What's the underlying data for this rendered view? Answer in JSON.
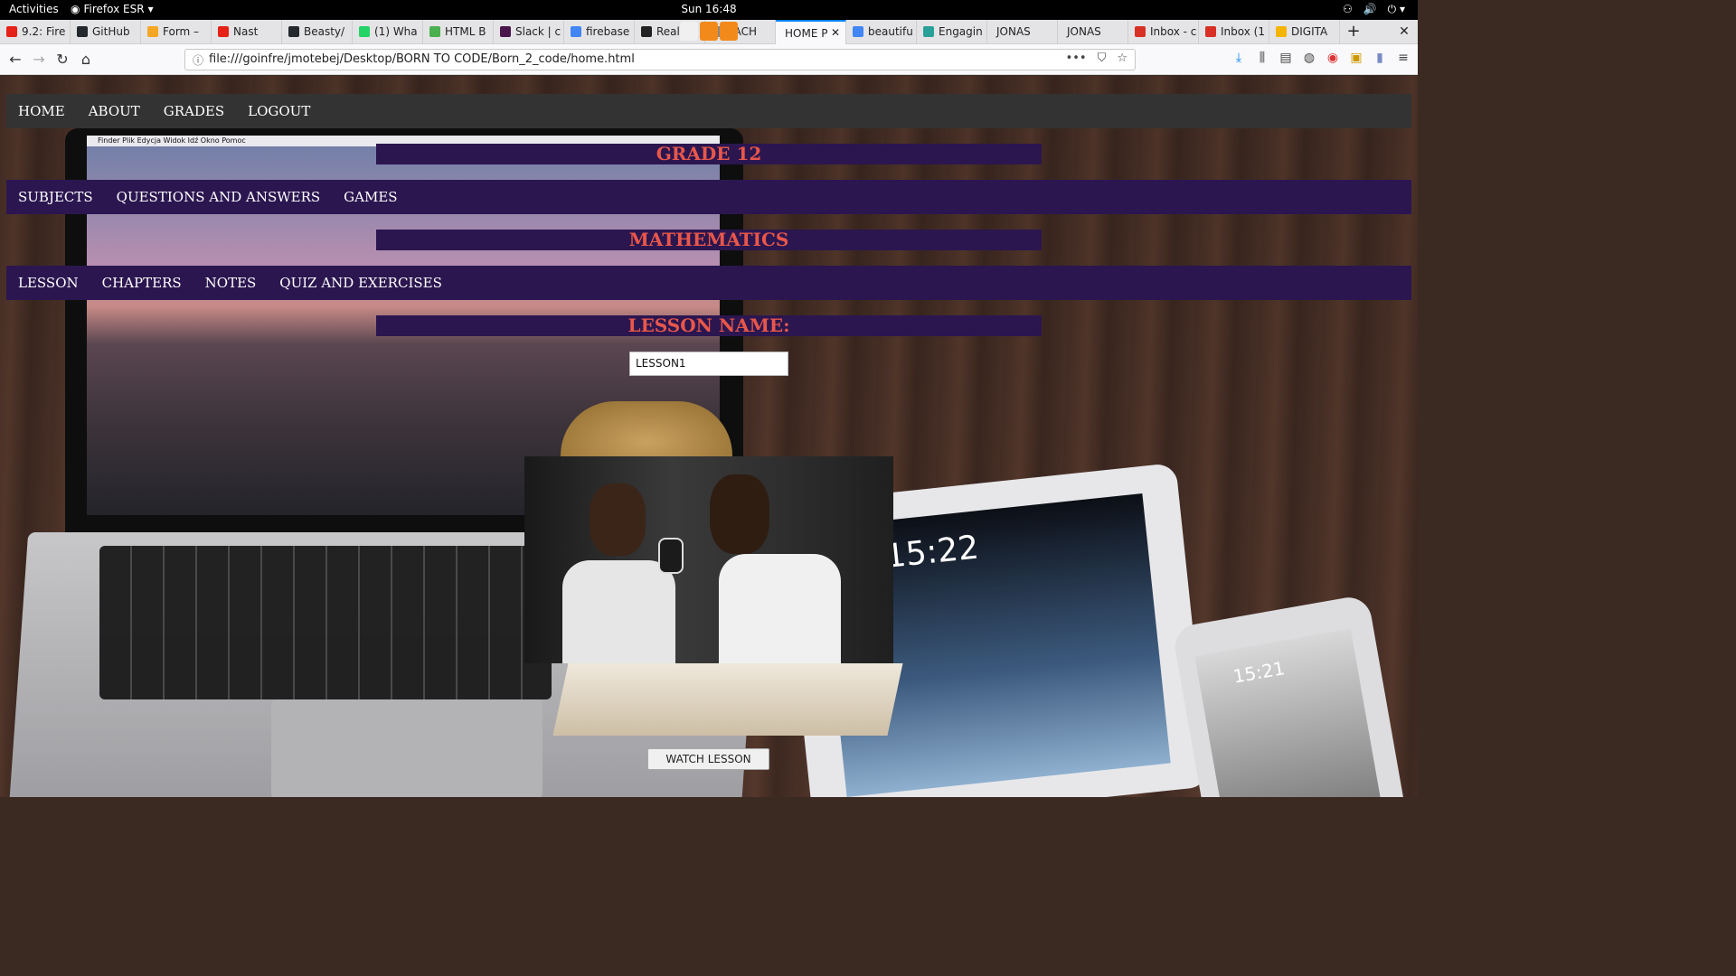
{
  "system_bar": {
    "activities": "Activities",
    "app_name": "Firefox ESR",
    "clock": "Sun 16:48",
    "icons": [
      "network-icon",
      "volume-icon",
      "power-icon"
    ]
  },
  "browser": {
    "tabs": [
      {
        "label": "9.2: Fire",
        "icon": "youtube-icon",
        "color": "#e62117"
      },
      {
        "label": "GitHub",
        "icon": "github-icon",
        "color": "#24292e"
      },
      {
        "label": "Form –",
        "icon": "firebase-icon",
        "color": "#f5a623"
      },
      {
        "label": "Nast",
        "icon": "youtube-icon",
        "color": "#e62117"
      },
      {
        "label": "Beasty/",
        "icon": "github-icon",
        "color": "#24292e"
      },
      {
        "label": "(1) Wha",
        "icon": "whatsapp-icon",
        "color": "#25d366"
      },
      {
        "label": "HTML B",
        "icon": "w3-icon",
        "color": "#4caf50"
      },
      {
        "label": "Slack | c",
        "icon": "slack-icon",
        "color": "#4a154b"
      },
      {
        "label": "firebase",
        "icon": "google-icon",
        "color": "#4285f4"
      },
      {
        "label": "Real",
        "icon": "page-icon",
        "color": "#222222"
      },
      {
        "label": "EACH",
        "icon": "page-icon",
        "color": "#888888"
      },
      {
        "label": "HOME P",
        "icon": "none",
        "color": "#ffffff",
        "active": true
      },
      {
        "label": "beautifu",
        "icon": "google-icon",
        "color": "#4285f4"
      },
      {
        "label": "Engagin",
        "icon": "doc-icon",
        "color": "#2aa198"
      },
      {
        "label": "JONAS",
        "icon": "none",
        "color": "#ffffff"
      },
      {
        "label": "JONAS",
        "icon": "none",
        "color": "#ffffff"
      },
      {
        "label": "Inbox - c",
        "icon": "gmail-icon",
        "color": "#d93025"
      },
      {
        "label": "Inbox (1",
        "icon": "gmail-icon",
        "color": "#d93025"
      },
      {
        "label": "DIGITA",
        "icon": "slides-icon",
        "color": "#f4b400"
      }
    ],
    "new_tab": "+",
    "url": "file:///goinfre/jmotebej/Desktop/BORN TO CODE/Born_2_code/home.html",
    "accent": "#0a84ff"
  },
  "site": {
    "nav": [
      "HOME",
      "ABOUT",
      "GRADES",
      "LOGOUT"
    ],
    "grade_heading": "GRADE 12",
    "grade_nav": [
      "SUBJECTS",
      "QUESTIONS AND ANSWERS",
      "GAMES"
    ],
    "subject_heading": "MATHEMATICS",
    "subject_nav": [
      "LESSON",
      "CHAPTERS",
      "NOTES",
      "QUIZ AND EXERCISES"
    ],
    "lesson_heading": "LESSON NAME:",
    "lesson_input_value": "LESSON1",
    "watch_button": "WATCH LESSON",
    "colors": {
      "nav_bg": "#333333",
      "band_bg": "#2b1650",
      "heading_text": "#e8574a"
    }
  },
  "background_photo": {
    "mac_menubar": "Finder  Plik  Edycja  Widok  Idź  Okno  Pomoc",
    "tablet_time": "15:22",
    "phone_time": "15:21"
  }
}
